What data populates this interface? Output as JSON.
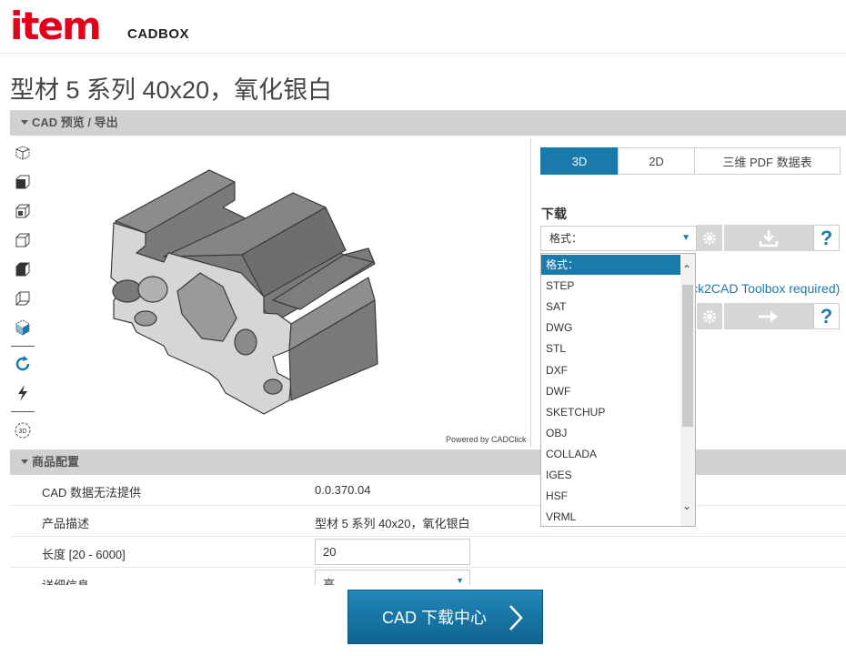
{
  "header": {
    "logo": "item",
    "logo_sub": "CADBOX"
  },
  "page_title": "型材 5 系列 40x20，氧化银白",
  "cad_section": {
    "title": "CAD 预览 / 导出",
    "powered_by": "Powered by CADClick"
  },
  "toolbar": [
    "iso-view-icon",
    "front-view-icon",
    "left-view-icon",
    "top-view-icon",
    "right-view-icon",
    "back-view-icon",
    "bottom-view-icon",
    "rotate-icon",
    "flash-icon",
    "3d-icon"
  ],
  "tabs": [
    {
      "label": "3D",
      "active": true
    },
    {
      "label": "2D",
      "active": false
    },
    {
      "label": "三维 PDF 数据表",
      "active": false
    }
  ],
  "download": {
    "label": "下载",
    "format_placeholder": "格式：",
    "click2cad_text": "ick2CAD Toolbox required)",
    "help": "?"
  },
  "format_options": [
    "格式：",
    "STEP",
    "SAT",
    "DWG",
    "STL",
    "DXF",
    "DWF",
    "SKETCHUP",
    "OBJ",
    "COLLADA",
    "IGES",
    "HSF",
    "VRML"
  ],
  "product_config": {
    "title": "商品配置",
    "rows": [
      {
        "label": "CAD 数据无法提供",
        "value": "0.0.370.04"
      },
      {
        "label": "产品描述",
        "value": "型材 5 系列 40x20，氧化银白"
      },
      {
        "label": "长度 [20 - 6000]",
        "input": "20"
      },
      {
        "label": "详细信息",
        "select": "高"
      }
    ]
  },
  "cta": {
    "label": "CAD 下载中心"
  },
  "colors": {
    "brand_red": "#e2001a",
    "accent_blue": "#1a7aab",
    "bar_gray": "#d1d1d1"
  }
}
